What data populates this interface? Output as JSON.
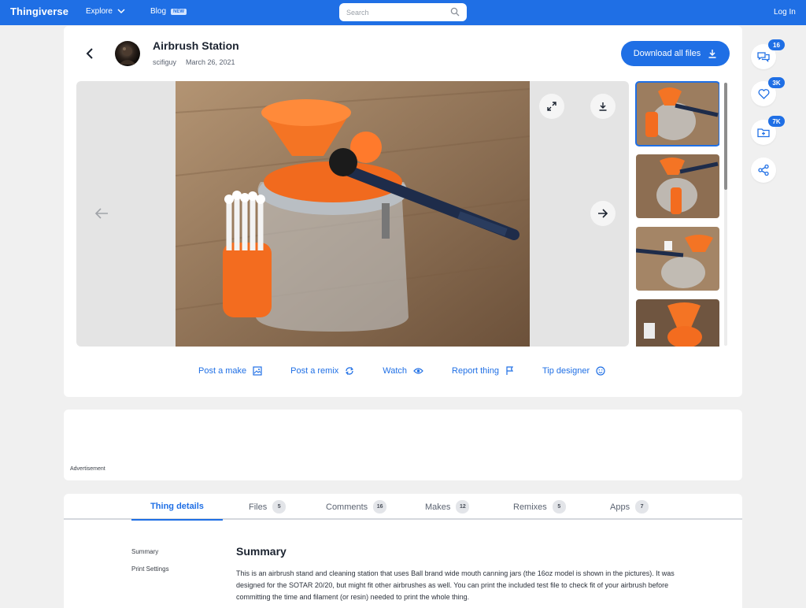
{
  "nav": {
    "logo": "Thingiverse",
    "explore": "Explore",
    "blog": "Blog",
    "blog_badge": "NEW",
    "search_placeholder": "Search",
    "login": "Log In",
    "brand_color": "#1f6fe5"
  },
  "thing": {
    "title": "Airbrush Station",
    "author": "scifiguy",
    "date": "March 26, 2021",
    "download_all": "Download all files"
  },
  "gallery": {
    "thumbnail_count": 4,
    "active_thumbnail": 1
  },
  "actions": [
    {
      "label": "Post a make",
      "icon": "image-icon"
    },
    {
      "label": "Post a remix",
      "icon": "remix-icon"
    },
    {
      "label": "Watch",
      "icon": "eye-icon"
    },
    {
      "label": "Report thing",
      "icon": "flag-icon"
    },
    {
      "label": "Tip designer",
      "icon": "smile-icon"
    }
  ],
  "floating": {
    "comments": "16",
    "likes": "3K",
    "collects": "7K"
  },
  "ad": {
    "label": "Advertisement"
  },
  "tabs": [
    {
      "label": "Thing details",
      "count": ""
    },
    {
      "label": "Files",
      "count": "5"
    },
    {
      "label": "Comments",
      "count": "16"
    },
    {
      "label": "Makes",
      "count": "12"
    },
    {
      "label": "Remixes",
      "count": "5"
    },
    {
      "label": "Apps",
      "count": "7"
    }
  ],
  "details": {
    "side_nav": [
      "Summary",
      "Print Settings"
    ],
    "summary_title": "Summary",
    "summary_text": "This is an airbrush stand and cleaning station that uses Ball brand wide mouth canning jars (the 16oz model is shown in the pictures).  It was designed for the SOTAR 20/20, but might fit other airbrushes as well.  You can print the included test file to check fit of your airbrush before committing the time and filament (or resin) needed to print the whole thing."
  }
}
